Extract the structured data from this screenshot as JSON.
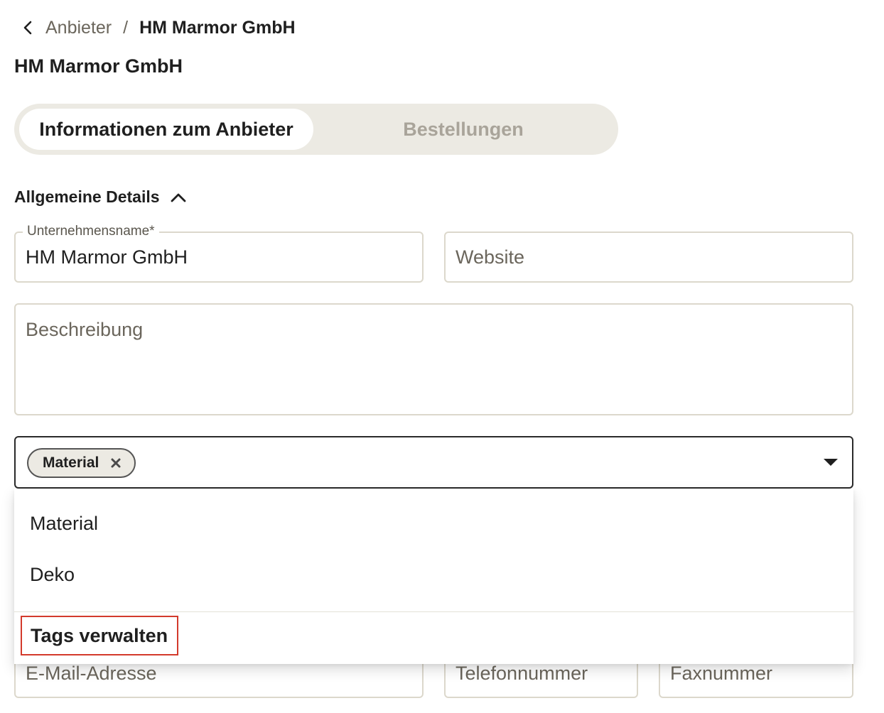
{
  "breadcrumb": {
    "back_icon": "chevron-left-icon",
    "parent": "Anbieter",
    "separator": "/",
    "current": "HM Marmor GmbH"
  },
  "page_title": "HM Marmor GmbH",
  "tabs": [
    {
      "label": "Informationen zum Anbieter",
      "active": true
    },
    {
      "label": "Bestellungen",
      "active": false
    }
  ],
  "section": {
    "title": "Allgemeine Details",
    "toggle_icon": "chevron-up-icon"
  },
  "fields": {
    "company_name": {
      "label": "Unternehmensname*",
      "value": "HM Marmor GmbH"
    },
    "website": {
      "placeholder": "Website"
    },
    "description": {
      "placeholder": "Beschreibung"
    },
    "email": {
      "placeholder": "E-Mail-Adresse"
    },
    "phone": {
      "placeholder": "Telefonnummer"
    },
    "fax": {
      "placeholder": "Faxnummer"
    }
  },
  "tags": {
    "selected": [
      {
        "label": "Material",
        "remove_icon": "close-icon"
      }
    ],
    "dropdown_icon": "caret-down-icon",
    "options": [
      "Material",
      "Deko"
    ],
    "manage_label": "Tags verwalten"
  },
  "colors": {
    "tab_track": "#eceae3",
    "border": "#dcd8cc",
    "highlight": "#d33a2c"
  }
}
